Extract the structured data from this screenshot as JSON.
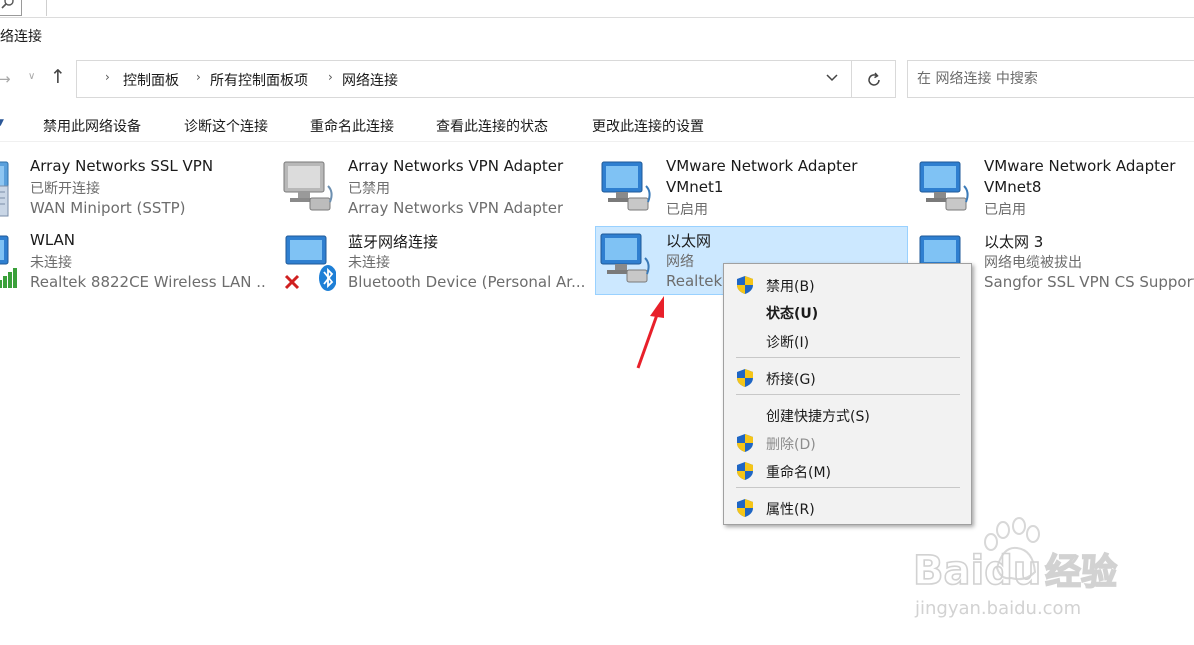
{
  "window": {
    "title": "络连接"
  },
  "search": {
    "placeholder": "在 网络连接 中搜索"
  },
  "breadcrumb": [
    "控制面板",
    "所有控制面板项",
    "网络连接"
  ],
  "commands": [
    "禁用此网络设备",
    "诊断这个连接",
    "重命名此连接",
    "查看此连接的状态",
    "更改此连接的设置"
  ],
  "connections": [
    {
      "name": "Array Networks SSL VPN",
      "status": "已断开连接",
      "device": "WAN Miniport (SSTP)",
      "icon": "vpn-monitor-icon"
    },
    {
      "name": "Array Networks VPN Adapter",
      "status": "已禁用",
      "device": "Array Networks VPN Adapter",
      "icon": "disabled-network-icon"
    },
    {
      "name": "VMware Network Adapter",
      "status": "VMnet1",
      "device": "已启用",
      "icon": "network-adapter-icon"
    },
    {
      "name": "VMware Network Adapter",
      "status": "VMnet8",
      "device": "已启用",
      "icon": "network-adapter-icon"
    },
    {
      "name": "WLAN",
      "status": "未连接",
      "device": "Realtek 8822CE Wireless LAN ...",
      "icon": "wifi-signal-icon"
    },
    {
      "name": "蓝牙网络连接",
      "status": "未连接",
      "device": "Bluetooth Device (Personal Ar...",
      "icon": "bluetooth-icon"
    },
    {
      "name": "以太网",
      "status": "网络",
      "device": "Realtek",
      "icon": "network-adapter-icon",
      "selected": true
    },
    {
      "name": "以太网 3",
      "status": "网络电缆被拔出",
      "device": "Sangfor SSL VPN CS Support",
      "icon": "network-adapter-icon"
    }
  ],
  "context_menu": [
    {
      "label": "禁用(B)",
      "shield": true
    },
    {
      "label": "状态(U)",
      "bold": true
    },
    {
      "label": "诊断(I)"
    },
    {
      "label": "桥接(G)",
      "shield": true
    },
    {
      "label": "创建快捷方式(S)"
    },
    {
      "label": "删除(D)",
      "shield": true,
      "disabled": true
    },
    {
      "label": "重命名(M)",
      "shield": true
    },
    {
      "label": "属性(R)",
      "shield": true
    }
  ],
  "watermark": {
    "brand": "Baidu",
    "cn": "经验",
    "url": "jingyan.baidu.com"
  },
  "colors": {
    "selection": "#cce8ff",
    "selection_border": "#99d1ff",
    "arrow": "#e8202a",
    "menu_bg": "#f2f2f2"
  }
}
